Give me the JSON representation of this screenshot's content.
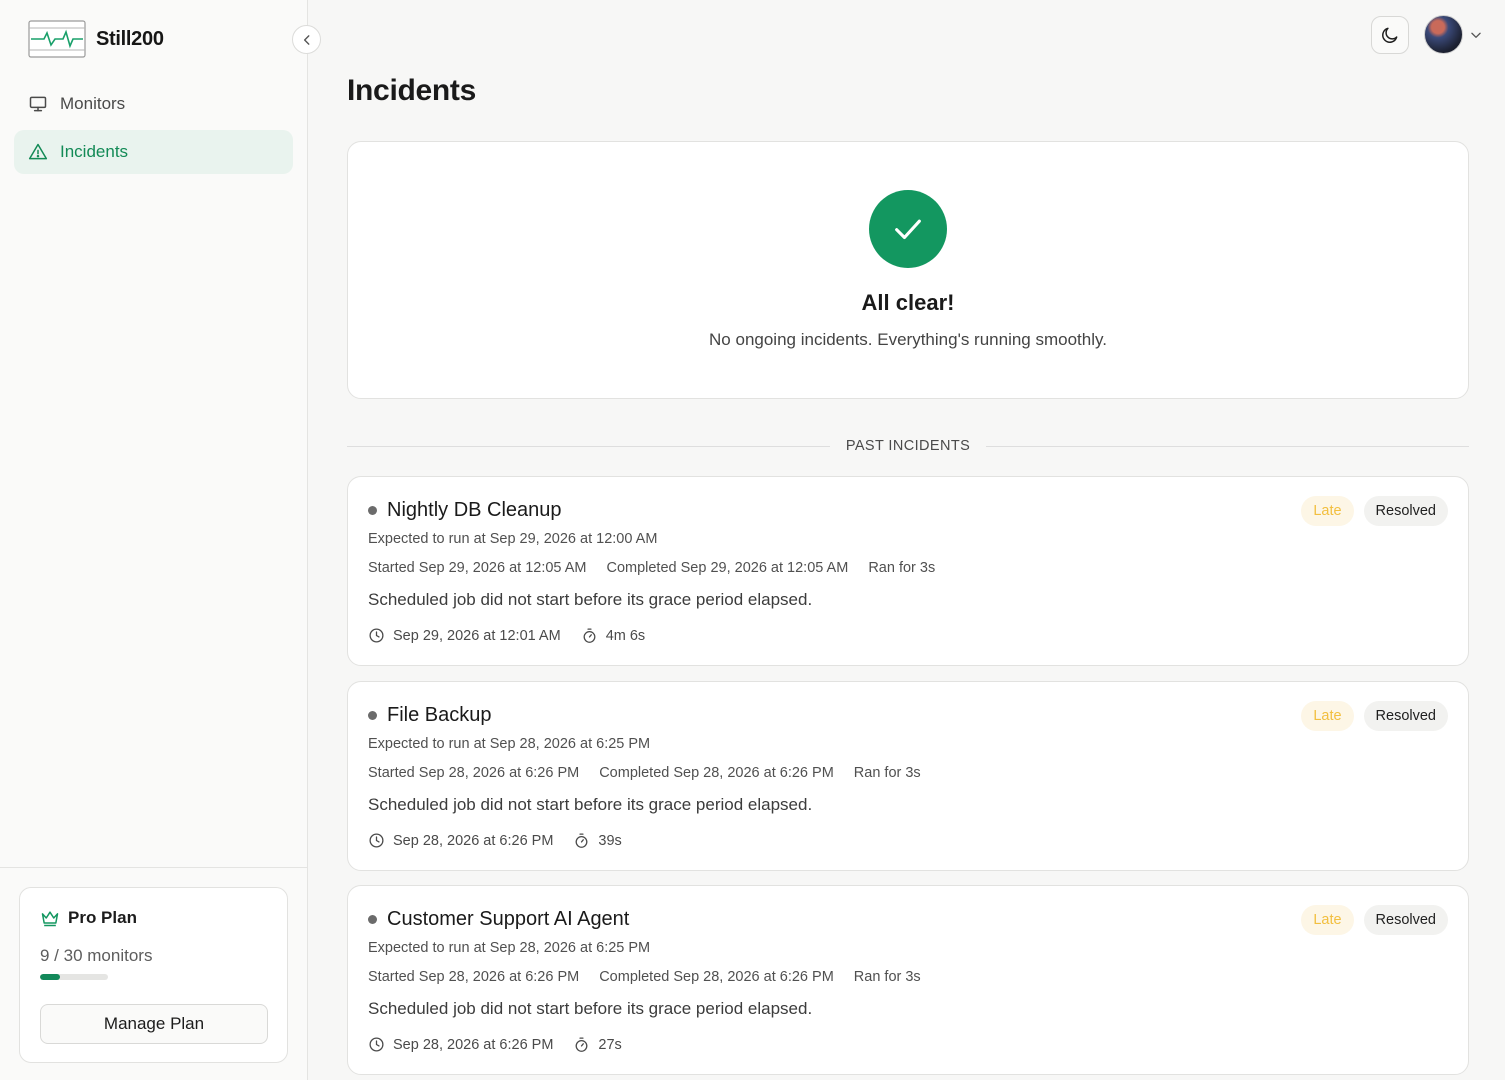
{
  "brand": {
    "name": "Still200"
  },
  "sidebar": {
    "items": [
      {
        "label": "Monitors",
        "icon": "monitor-icon",
        "active": false
      },
      {
        "label": "Incidents",
        "icon": "alert-triangle-icon",
        "active": true
      }
    ],
    "plan": {
      "name": "Pro Plan",
      "icon": "crown-icon",
      "usage": "9 / 30 monitors",
      "used": 9,
      "limit": 30,
      "manage_label": "Manage Plan"
    }
  },
  "header": {
    "theme_icon": "moon-icon",
    "avatar_icon": "avatar",
    "menu_icon": "chevron-down-icon"
  },
  "main": {
    "title": "Incidents",
    "status": {
      "title": "All clear!",
      "subtitle": "No ongoing incidents. Everything's running smoothly."
    },
    "past_label": "PAST INCIDENTS",
    "incidents": [
      {
        "title": "Nightly DB Cleanup",
        "badge_late": "Late",
        "badge_status": "Resolved",
        "expected": "Expected to run at Sep 29, 2026 at 12:00 AM",
        "started": "Started Sep 29, 2026 at 12:05 AM",
        "completed": "Completed Sep 29, 2026 at 12:05 AM",
        "ran_for": "Ran for 3s",
        "description": "Scheduled job did not start before its grace period elapsed.",
        "detected_at": "Sep 29, 2026 at 12:01 AM",
        "duration": "4m 6s"
      },
      {
        "title": "File Backup",
        "badge_late": "Late",
        "badge_status": "Resolved",
        "expected": "Expected to run at Sep 28, 2026 at 6:25 PM",
        "started": "Started Sep 28, 2026 at 6:26 PM",
        "completed": "Completed Sep 28, 2026 at 6:26 PM",
        "ran_for": "Ran for 3s",
        "description": "Scheduled job did not start before its grace period elapsed.",
        "detected_at": "Sep 28, 2026 at 6:26 PM",
        "duration": "39s"
      },
      {
        "title": "Customer Support AI Agent",
        "badge_late": "Late",
        "badge_status": "Resolved",
        "expected": "Expected to run at Sep 28, 2026 at 6:25 PM",
        "started": "Started Sep 28, 2026 at 6:26 PM",
        "completed": "Completed Sep 28, 2026 at 6:26 PM",
        "ran_for": "Ran for 3s",
        "description": "Scheduled job did not start before its grace period elapsed.",
        "detected_at": "Sep 28, 2026 at 6:26 PM",
        "duration": "27s"
      }
    ]
  },
  "colors": {
    "accent": "#139760",
    "accent_bg": "#e9f3ee",
    "late_text": "#f2bf3f",
    "late_bg": "#fdf6e6"
  }
}
